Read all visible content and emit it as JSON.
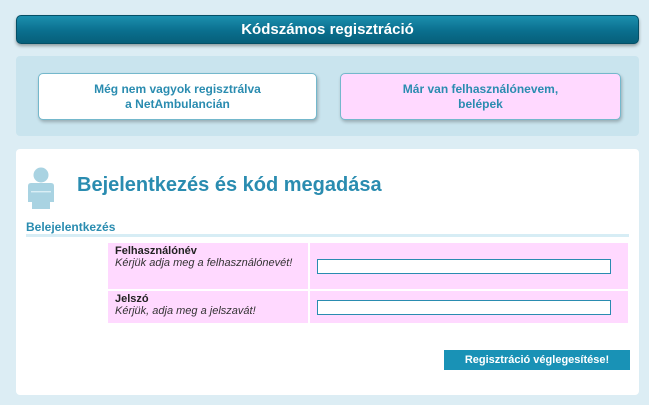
{
  "header": {
    "title": "Kódszámos regisztráció"
  },
  "choices": {
    "register_label": "Még nem vagyok regisztrálva\na NetAmbulancián",
    "login_label": "Már van felhasználónevem,\nbelépek"
  },
  "login": {
    "title": "Bejelentkezés és kód megadása",
    "section_label": "Belejelentkezés",
    "username": {
      "label": "Felhasználónév",
      "hint": "Kérjük adja meg a felhasználónevét!",
      "value": ""
    },
    "password": {
      "label": "Jelszó",
      "hint": "Kérjük, adja meg a jelszavát!",
      "value": ""
    },
    "submit_label": "Regisztráció véglegesítése!"
  },
  "colors": {
    "accent": "#2a8cb0",
    "header_bg": "#0a6f8e",
    "highlight_bg": "#ffd9ff",
    "panel_bg": "#c9e4ee",
    "page_bg": "#dcedf4"
  },
  "icons": {
    "avatar": "user-avatar-icon"
  }
}
